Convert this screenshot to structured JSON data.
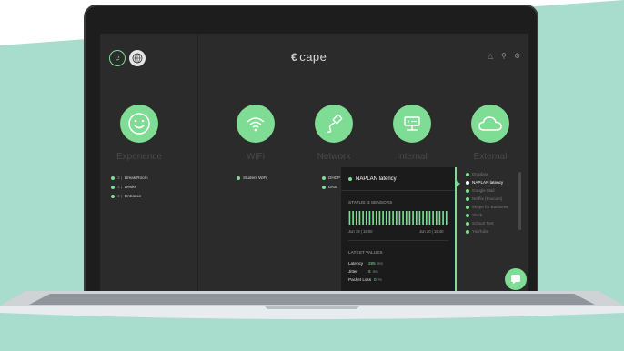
{
  "app": {
    "brand": "cape"
  },
  "categories": [
    {
      "key": "experience",
      "label": "Experience",
      "icon": "smiley-icon"
    },
    {
      "key": "wifi",
      "label": "WiFi",
      "icon": "wifi-icon"
    },
    {
      "key": "network",
      "label": "Network",
      "icon": "cable-icon"
    },
    {
      "key": "internal",
      "label": "Internal",
      "icon": "server-icon"
    },
    {
      "key": "external",
      "label": "External",
      "icon": "cloud-icon"
    }
  ],
  "experience_items": [
    {
      "count": "3 |",
      "label": "Break Room"
    },
    {
      "count": "3 |",
      "label": "Desks"
    },
    {
      "count": "3 |",
      "label": "Entrance"
    }
  ],
  "wifi_items": [
    {
      "label": "Student WiFi"
    }
  ],
  "network_items": [
    {
      "label": "DHCP"
    },
    {
      "label": "DNS"
    }
  ],
  "external_items": [
    {
      "label": "Dropbox",
      "active": false
    },
    {
      "label": "NAPLAN latency",
      "active": true
    },
    {
      "label": "Google Mail",
      "active": false
    },
    {
      "label": "Netflix (Foxcom)",
      "active": false
    },
    {
      "label": "Skype for Business",
      "active": false
    },
    {
      "label": "Slack",
      "active": false
    },
    {
      "label": "School Test",
      "active": false
    },
    {
      "label": "YouTube",
      "active": false
    }
  ],
  "popup": {
    "title": "NAPLAN latency",
    "status": "STATUS: 3 SENSORS",
    "bar_count": 30,
    "date_start": "Jun 19 | 16:00",
    "date_end": "Jun 20 | 15:40",
    "latest_heading": "LATEST VALUES",
    "metrics": [
      {
        "name": "Latency",
        "value": "285",
        "unit": "ms"
      },
      {
        "name": "Jitter",
        "value": "5",
        "unit": "ms"
      },
      {
        "name": "Packet Loss",
        "value": "0",
        "unit": "%"
      }
    ]
  },
  "colors": {
    "accent": "#7fdc94",
    "screen_bg": "#2b2b2b",
    "panel_bg": "#1b1b1b",
    "teal_bg": "#a8dccc"
  }
}
